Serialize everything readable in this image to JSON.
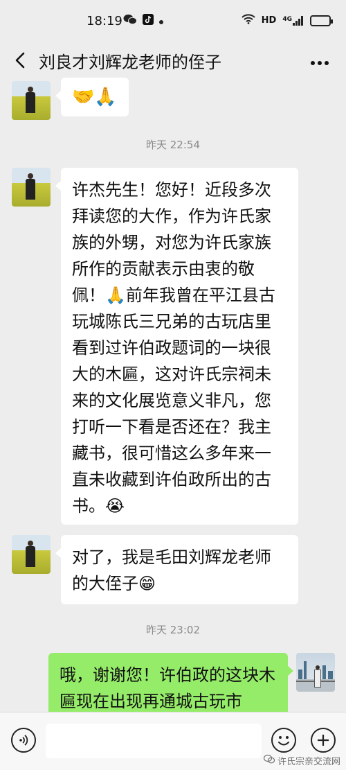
{
  "status_bar": {
    "time": "18:19",
    "network_label": "HD",
    "signal_label": "4G",
    "battery_level": 0.8,
    "battery_color": "#f5c518"
  },
  "header": {
    "title": "刘良才刘辉龙老师的侄子",
    "back_icon": "chevron-left-icon",
    "more_icon": "more-dots-icon"
  },
  "messages": [
    {
      "side": "left",
      "text": "🤝🙏"
    },
    {
      "type": "time",
      "text": "昨天 22:54"
    },
    {
      "side": "left",
      "text": "许杰先生！您好！近段多次拜读您的大作，作为许氏家族的外甥，对您为许氏家族所作的贡献表示由衷的敬佩！🙏前年我曾在平江县古玩城陈氏三兄弟的古玩店里看到过许伯政题词的一块很大的木匾，这对许氏宗祠未来的文化展览意义非凡，您打听一下看是否还在？我主藏书，很可惜这么多年来一直未收藏到许伯政所出的古书。😭"
    },
    {
      "side": "left",
      "text": "对了，我是毛田刘辉龙老师的大侄子😁"
    },
    {
      "type": "time",
      "text": "昨天 23:02"
    },
    {
      "side": "right",
      "text": "哦，谢谢您！许伯政的这块木匾现在出现再通城古玩市"
    }
  ],
  "input_bar": {
    "voice_icon": "voice-icon",
    "emoji_icon": "emoji-icon",
    "plus_icon": "plus-icon",
    "value": ""
  },
  "watermark": "许氏宗亲交流网",
  "colors": {
    "background": "#ededed",
    "bubble_left": "#ffffff",
    "bubble_right": "#95ec69",
    "timestamp": "#8a8a8a"
  }
}
